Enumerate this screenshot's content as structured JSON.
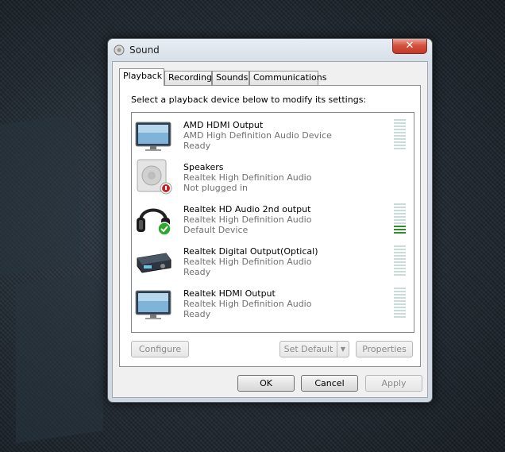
{
  "window": {
    "title": "Sound",
    "close_symbol": "✕"
  },
  "tabs": [
    {
      "label": "Playback",
      "active": true
    },
    {
      "label": "Recording",
      "active": false
    },
    {
      "label": "Sounds",
      "active": false
    },
    {
      "label": "Communications",
      "active": false
    }
  ],
  "playback": {
    "prompt": "Select a playback device below to modify its settings:",
    "devices": [
      {
        "name": "AMD HDMI Output",
        "description": "AMD High Definition Audio Device",
        "status": "Ready",
        "icon": "monitor-icon",
        "level": 0
      },
      {
        "name": "Speakers",
        "description": "Realtek High Definition Audio",
        "status": "Not plugged in",
        "icon": "speaker-icon",
        "badge": "unplugged-badge-icon"
      },
      {
        "name": "Realtek HD Audio 2nd output",
        "description": "Realtek High Definition Audio",
        "status": "Default Device",
        "icon": "headphones-icon",
        "badge": "default-check-icon",
        "level": 0.25
      },
      {
        "name": "Realtek Digital Output(Optical)",
        "description": "Realtek High Definition Audio",
        "status": "Ready",
        "icon": "receiver-icon",
        "level": 0
      },
      {
        "name": "Realtek HDMI Output",
        "description": "Realtek High Definition Audio",
        "status": "Ready",
        "icon": "monitor-icon",
        "level": 0
      }
    ],
    "buttons": {
      "configure": "Configure",
      "set_default": "Set Default",
      "properties": "Properties"
    }
  },
  "footer": {
    "ok": "OK",
    "cancel": "Cancel",
    "apply": "Apply"
  },
  "colors": {
    "meter_on": "#2e8b2e",
    "meter_off": "#c8dcd8",
    "check_green": "#2ea82e",
    "badge_red": "#c0262a"
  }
}
